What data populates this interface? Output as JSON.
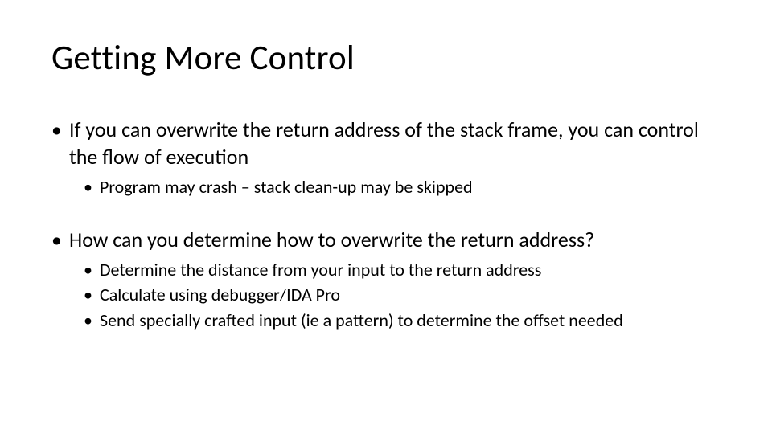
{
  "slide": {
    "title": "Getting More Control",
    "bullets": [
      {
        "text": "If you can overwrite the return address of the stack frame, you can control the flow of execution",
        "sub": [
          "Program may crash – stack clean-up may be skipped"
        ]
      },
      {
        "text": "How can you determine how to overwrite the return address?",
        "sub": [
          "Determine the distance from your input to the return address",
          "Calculate using debugger/IDA Pro",
          "Send specially crafted input (ie a pattern) to determine the offset needed"
        ]
      }
    ]
  }
}
